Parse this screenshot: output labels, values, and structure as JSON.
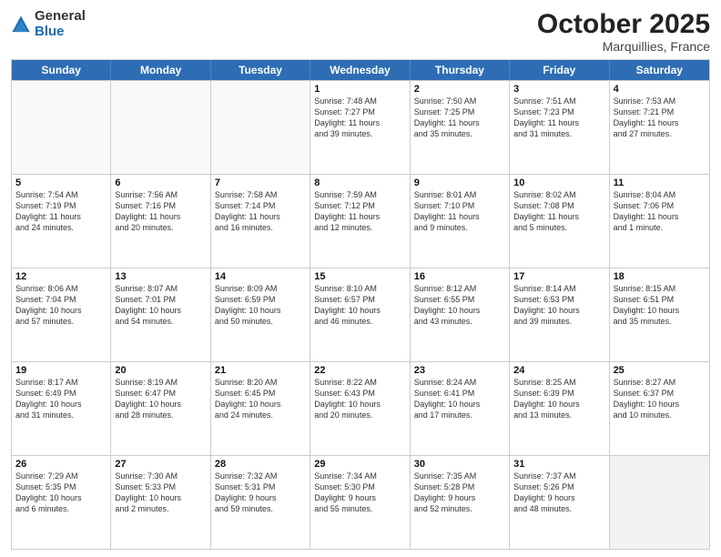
{
  "header": {
    "logo_general": "General",
    "logo_blue": "Blue",
    "title": "October 2025",
    "location": "Marquillies, France"
  },
  "days_of_week": [
    "Sunday",
    "Monday",
    "Tuesday",
    "Wednesday",
    "Thursday",
    "Friday",
    "Saturday"
  ],
  "weeks": [
    [
      {
        "day": "",
        "text": ""
      },
      {
        "day": "",
        "text": ""
      },
      {
        "day": "",
        "text": ""
      },
      {
        "day": "1",
        "text": "Sunrise: 7:48 AM\nSunset: 7:27 PM\nDaylight: 11 hours\nand 39 minutes."
      },
      {
        "day": "2",
        "text": "Sunrise: 7:50 AM\nSunset: 7:25 PM\nDaylight: 11 hours\nand 35 minutes."
      },
      {
        "day": "3",
        "text": "Sunrise: 7:51 AM\nSunset: 7:23 PM\nDaylight: 11 hours\nand 31 minutes."
      },
      {
        "day": "4",
        "text": "Sunrise: 7:53 AM\nSunset: 7:21 PM\nDaylight: 11 hours\nand 27 minutes."
      }
    ],
    [
      {
        "day": "5",
        "text": "Sunrise: 7:54 AM\nSunset: 7:19 PM\nDaylight: 11 hours\nand 24 minutes."
      },
      {
        "day": "6",
        "text": "Sunrise: 7:56 AM\nSunset: 7:16 PM\nDaylight: 11 hours\nand 20 minutes."
      },
      {
        "day": "7",
        "text": "Sunrise: 7:58 AM\nSunset: 7:14 PM\nDaylight: 11 hours\nand 16 minutes."
      },
      {
        "day": "8",
        "text": "Sunrise: 7:59 AM\nSunset: 7:12 PM\nDaylight: 11 hours\nand 12 minutes."
      },
      {
        "day": "9",
        "text": "Sunrise: 8:01 AM\nSunset: 7:10 PM\nDaylight: 11 hours\nand 9 minutes."
      },
      {
        "day": "10",
        "text": "Sunrise: 8:02 AM\nSunset: 7:08 PM\nDaylight: 11 hours\nand 5 minutes."
      },
      {
        "day": "11",
        "text": "Sunrise: 8:04 AM\nSunset: 7:06 PM\nDaylight: 11 hours\nand 1 minute."
      }
    ],
    [
      {
        "day": "12",
        "text": "Sunrise: 8:06 AM\nSunset: 7:04 PM\nDaylight: 10 hours\nand 57 minutes."
      },
      {
        "day": "13",
        "text": "Sunrise: 8:07 AM\nSunset: 7:01 PM\nDaylight: 10 hours\nand 54 minutes."
      },
      {
        "day": "14",
        "text": "Sunrise: 8:09 AM\nSunset: 6:59 PM\nDaylight: 10 hours\nand 50 minutes."
      },
      {
        "day": "15",
        "text": "Sunrise: 8:10 AM\nSunset: 6:57 PM\nDaylight: 10 hours\nand 46 minutes."
      },
      {
        "day": "16",
        "text": "Sunrise: 8:12 AM\nSunset: 6:55 PM\nDaylight: 10 hours\nand 43 minutes."
      },
      {
        "day": "17",
        "text": "Sunrise: 8:14 AM\nSunset: 6:53 PM\nDaylight: 10 hours\nand 39 minutes."
      },
      {
        "day": "18",
        "text": "Sunrise: 8:15 AM\nSunset: 6:51 PM\nDaylight: 10 hours\nand 35 minutes."
      }
    ],
    [
      {
        "day": "19",
        "text": "Sunrise: 8:17 AM\nSunset: 6:49 PM\nDaylight: 10 hours\nand 31 minutes."
      },
      {
        "day": "20",
        "text": "Sunrise: 8:19 AM\nSunset: 6:47 PM\nDaylight: 10 hours\nand 28 minutes."
      },
      {
        "day": "21",
        "text": "Sunrise: 8:20 AM\nSunset: 6:45 PM\nDaylight: 10 hours\nand 24 minutes."
      },
      {
        "day": "22",
        "text": "Sunrise: 8:22 AM\nSunset: 6:43 PM\nDaylight: 10 hours\nand 20 minutes."
      },
      {
        "day": "23",
        "text": "Sunrise: 8:24 AM\nSunset: 6:41 PM\nDaylight: 10 hours\nand 17 minutes."
      },
      {
        "day": "24",
        "text": "Sunrise: 8:25 AM\nSunset: 6:39 PM\nDaylight: 10 hours\nand 13 minutes."
      },
      {
        "day": "25",
        "text": "Sunrise: 8:27 AM\nSunset: 6:37 PM\nDaylight: 10 hours\nand 10 minutes."
      }
    ],
    [
      {
        "day": "26",
        "text": "Sunrise: 7:29 AM\nSunset: 5:35 PM\nDaylight: 10 hours\nand 6 minutes."
      },
      {
        "day": "27",
        "text": "Sunrise: 7:30 AM\nSunset: 5:33 PM\nDaylight: 10 hours\nand 2 minutes."
      },
      {
        "day": "28",
        "text": "Sunrise: 7:32 AM\nSunset: 5:31 PM\nDaylight: 9 hours\nand 59 minutes."
      },
      {
        "day": "29",
        "text": "Sunrise: 7:34 AM\nSunset: 5:30 PM\nDaylight: 9 hours\nand 55 minutes."
      },
      {
        "day": "30",
        "text": "Sunrise: 7:35 AM\nSunset: 5:28 PM\nDaylight: 9 hours\nand 52 minutes."
      },
      {
        "day": "31",
        "text": "Sunrise: 7:37 AM\nSunset: 5:26 PM\nDaylight: 9 hours\nand 48 minutes."
      },
      {
        "day": "",
        "text": ""
      }
    ]
  ]
}
